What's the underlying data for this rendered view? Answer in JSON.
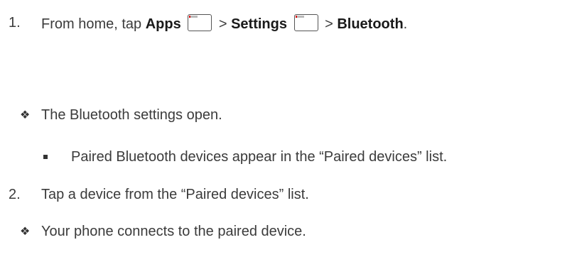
{
  "steps": [
    {
      "number": "1.",
      "prefix": "From home, tap ",
      "apps": "Apps",
      "sep1": " > ",
      "settings": "Settings",
      "sep2": " > ",
      "bluetooth": "Bluetooth",
      "suffix": "."
    },
    {
      "number": "2.",
      "text": "Tap a device from the “Paired devices” list."
    }
  ],
  "results": {
    "settings_open": "The Bluetooth settings open.",
    "paired_appear": "Paired Bluetooth devices appear in the “Paired devices” list.",
    "phone_connects": "Your phone connects to the paired device."
  },
  "icons": {
    "apps_icon": "apps-icon",
    "settings_icon": "settings-icon",
    "diamond_bullet": "diamond-bullet-icon",
    "square_bullet": "square-bullet-icon"
  }
}
